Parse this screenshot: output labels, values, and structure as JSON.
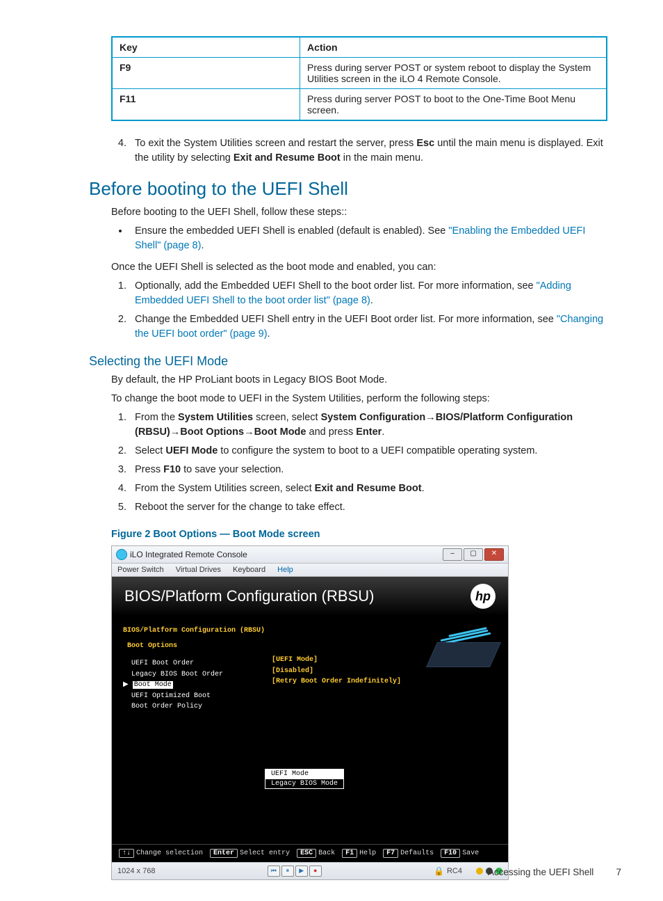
{
  "table": {
    "head_key": "Key",
    "head_action": "Action",
    "rows": [
      {
        "key": "F9",
        "action": "Press during server POST or system reboot to display the System Utilities screen in the iLO 4 Remote Console."
      },
      {
        "key": "F11",
        "action": "Press during server POST to boot to the One-Time Boot Menu screen."
      }
    ]
  },
  "step4": {
    "pre": "To exit the System Utilities screen and restart the server, press ",
    "esc": "Esc",
    "mid": " until the main menu is displayed. Exit the utility by selecting ",
    "exit": "Exit and Resume Boot",
    "post": " in the main menu."
  },
  "h1": "Before booting to the UEFI Shell",
  "intro": "Before booting to the UEFI Shell, follow these steps::",
  "bul1_pre": "Ensure the embedded UEFI Shell is enabled (default is enabled). See ",
  "bul1_link": "\"Enabling the Embedded UEFI Shell\" (page 8)",
  "bul1_post": ".",
  "once": "Once the UEFI Shell is selected as the boot mode and enabled, you can:",
  "ol1": {
    "i1_pre": "Optionally, add the Embedded UEFI Shell to the boot order list. For more information, see ",
    "i1_link": "\"Adding Embedded UEFI Shell to the boot order list\" (page 8)",
    "i1_post": ".",
    "i2_pre": "Change the Embedded UEFI Shell entry in the UEFI Boot order list. For more information, see ",
    "i2_link": "\"Changing the UEFI boot order\" (page 9)",
    "i2_post": "."
  },
  "h2": "Selecting the UEFI Mode",
  "p_default": "By default, the HP ProLiant boots in Legacy BIOS Boot Mode.",
  "p_change": "To change the boot mode to UEFI in the System Utilities, perform the following steps:",
  "steps": {
    "s1_a": "From the ",
    "s1_b": "System Utilities",
    "s1_c": " screen, select ",
    "s1_d": "System Configuration",
    "s1_e": "→",
    "s1_f": "BIOS/Platform Configuration (RBSU)",
    "s1_g": "→",
    "s1_h": "Boot Options",
    "s1_i": "→",
    "s1_j": "Boot Mode",
    "s1_k": " and press ",
    "s1_l": "Enter",
    "s1_m": ".",
    "s2_a": "Select ",
    "s2_b": "UEFI Mode",
    "s2_c": " to configure the system to boot to a UEFI compatible operating system.",
    "s3_a": "Press ",
    "s3_b": "F10",
    "s3_c": " to save your selection.",
    "s4_a": "From the System Utilities screen, select ",
    "s4_b": "Exit and Resume Boot",
    "s4_c": ".",
    "s5": "Reboot the server for the change to take effect."
  },
  "fig_caption": "Figure 2 Boot Options — Boot Mode screen",
  "window": {
    "title": "iLO Integrated Remote Console",
    "menu": {
      "m1": "Power Switch",
      "m2": "Virtual Drives",
      "m3": "Keyboard",
      "m4": "Help"
    },
    "rbsu_title": "BIOS/Platform Configuration (RBSU)",
    "hp": "hp",
    "left": {
      "l1": "BIOS/Platform Configuration (RBSU)",
      "l2": "Boot Options",
      "l3": "UEFI Boot Order",
      "l4": "Legacy BIOS Boot Order",
      "l5_marker": "▶",
      "l5": "Boot Mode",
      "l6": "UEFI Optimized Boot",
      "l7": "Boot Order Policy"
    },
    "vals": {
      "v1": "[UEFI Mode]",
      "v2": "[Disabled]",
      "v3": "[Retry Boot Order Indefinitely]"
    },
    "popup": {
      "sel": "UEFI Mode",
      "other": "Legacy BIOS Mode"
    },
    "footer": {
      "k1": "↑↓",
      "t1": "Change selection",
      "k2": "Enter",
      "t2": "Select entry",
      "k3": "ESC",
      "t3": "Back",
      "k4": "F1",
      "t4": "Help",
      "k5": "F7",
      "t5": "Defaults",
      "k6": "F10",
      "t6": "Save"
    },
    "status": {
      "res": "1024 x 768",
      "rc4": "RC4"
    }
  },
  "footer": {
    "text": "Accessing the UEFI Shell",
    "page": "7"
  }
}
